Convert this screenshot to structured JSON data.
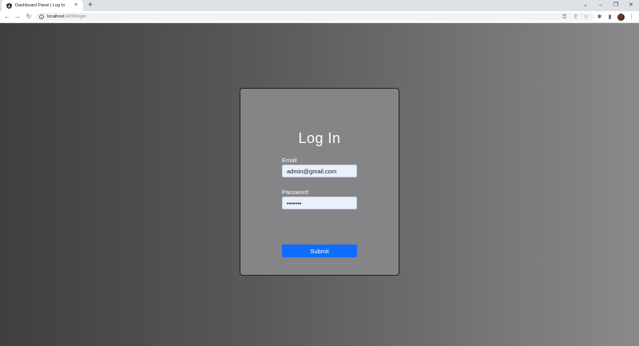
{
  "browser": {
    "tab": {
      "title": "Dashboard Panel | Log In",
      "favicon": "angular-logo-icon",
      "close_glyph": "×"
    },
    "new_tab_glyph": "+",
    "window_controls": {
      "tab_search_glyph": "⌄",
      "minimize_glyph": "–",
      "restore_glyph": "❐",
      "close_glyph": "✕"
    },
    "toolbar": {
      "back_glyph": "←",
      "forward_glyph": "→",
      "reload_glyph": "↻",
      "url_host": "localhost",
      "url_path": ":4200/login",
      "key_glyph": "⚿",
      "share_glyph": "⇪",
      "bookmark_glyph": "☆",
      "extensions_glyph": "✱",
      "sidepanel_glyph": "▮",
      "menu_glyph": "⋮"
    }
  },
  "login": {
    "title": "Log In",
    "email_label": "Email",
    "email_value": "admin@gmail.com",
    "password_label": "Password",
    "password_value": "•••••••",
    "submit_label": "Submit"
  },
  "colors": {
    "submit_bg": "#0d6efd",
    "card_bg": "#858486",
    "input_bg": "#e8f0fe"
  }
}
